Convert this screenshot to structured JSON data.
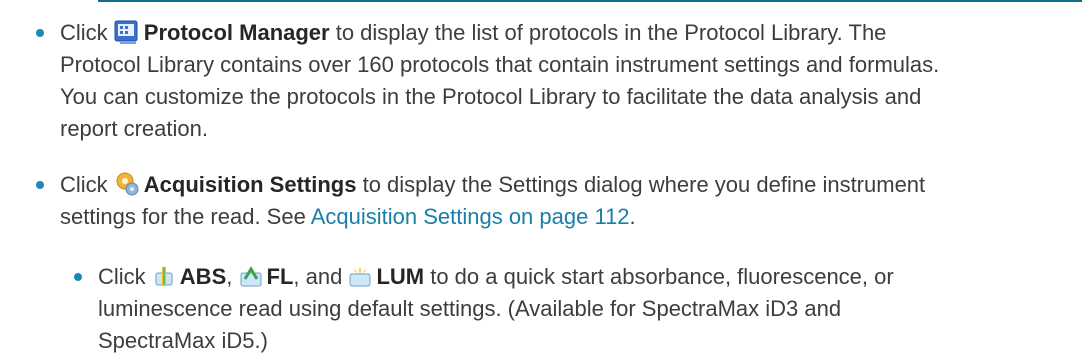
{
  "bullets": [
    {
      "line1": {
        "prefix": "Click",
        "icon": "protocol-manager-icon",
        "bold": "Protocol Manager",
        "rest": " to display the list of protocols in the Protocol Library. The"
      },
      "line2": "Protocol Library contains over 160 protocols that contain instrument settings and formulas.",
      "line3": "You can customize the protocols in the Protocol Library to facilitate the data analysis and",
      "line4": "report creation."
    },
    {
      "line1": {
        "prefix": "Click",
        "icon": "acquisition-settings-icon",
        "bold": "Acquisition Settings",
        "rest": " to display the Settings dialog where you define instrument"
      },
      "line2": {
        "text": "settings for the read. See ",
        "link": "Acquisition Settings on page 112",
        "end": "."
      }
    }
  ],
  "sub_bullet": {
    "line1": {
      "prefix": "Click",
      "abs_icon": "abs-read-icon",
      "abs": "ABS",
      "sep1": ",",
      "fl_icon": "fl-read-icon",
      "fl": "FL",
      "sep2": ", and",
      "lum_icon": "lum-read-icon",
      "lum": "LUM",
      "rest": " to do a quick start absorbance, fluorescence, or"
    },
    "line2": "luminescence read using default settings. (Available for SpectraMax iD3 and",
    "line3": "SpectraMax iD5.)"
  },
  "colors": {
    "bullet": "#1a88b7",
    "link": "#1a7ea8",
    "rule": "#0f6e8c",
    "text": "#3d3d3d"
  }
}
